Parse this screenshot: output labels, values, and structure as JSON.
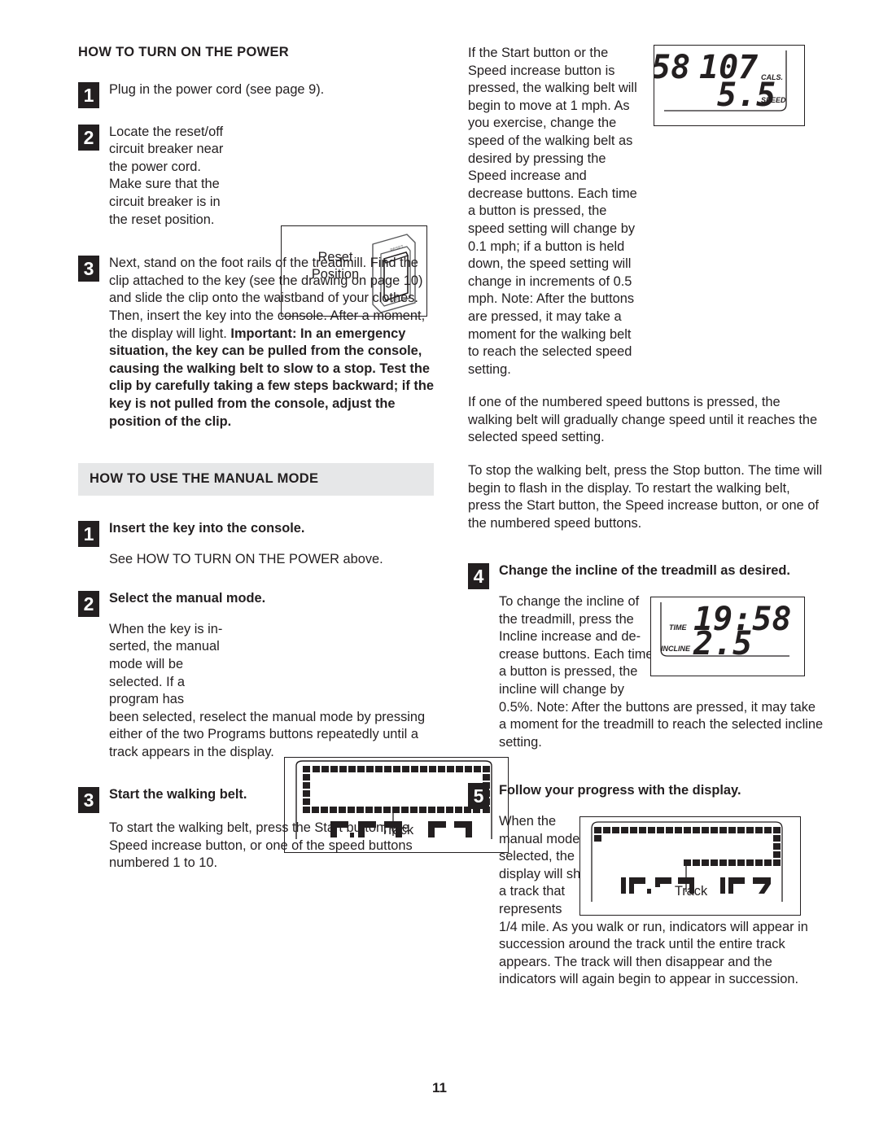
{
  "page": {
    "folio": "11"
  },
  "left_column": {
    "heading_power": "HOW TO TURN ON THE POWER",
    "heading_manual": "HOW TO USE THE MANUAL MODE",
    "steps_power": [
      {
        "num": "1",
        "text": "Plug in the power cord (see page 9)."
      },
      {
        "num": "2",
        "text": "Locate the reset/off circuit breaker near the power cord. Make sure that the circuit breaker is in the reset position."
      },
      {
        "num": "3",
        "text_normal": "Next, stand on the foot rails of the treadmill. Find the clip attached to the key (see the drawing on page 10) and slide the clip onto the waistband of your clothes. Then, insert the key into the console. After a moment, the display will light. ",
        "text_bold": "Important: In an emergency situation, the key can be pulled from the console, causing the walking belt to slow to a stop. Test the clip by carefully taking a few steps backward; if the key is not pulled from the console, adjust the position of the clip."
      }
    ],
    "steps_manual": [
      {
        "num": "1",
        "title": "Insert the key into the console.",
        "body": "See HOW TO TURN ON THE POWER above."
      },
      {
        "num": "2",
        "title": "Select the manual mode.",
        "body_wrap": "When the key is in-serted, the manual mode will be selected. If a program has",
        "body_rest": "been selected, reselect the manual mode by pressing either of the two Programs buttons repeatedly until a track appears in the display."
      },
      {
        "num": "3",
        "title": "Start the walking belt.",
        "body": "To start the walking belt, press the Start button, the Speed increase button, or one of the speed buttons numbered 1 to 10."
      }
    ]
  },
  "right_column": {
    "paragraphs": [
      "If the Start button or the Speed increase button is pressed, the walking belt will begin to move at 1 mph. As you exercise, change the speed of the walking belt as desired by pressing the Speed increase and decrease buttons. Each time a button is pressed, the speed setting will change by 0.1 mph; if a button is held down, the speed setting will change in increments of 0.5 mph. Note: After the buttons are pressed, it may take a moment for the walking belt to reach the selected speed setting.",
      "If one of the numbered speed buttons is pressed, the walking belt will gradually change speed until it reaches the selected speed setting.",
      "To stop the walking belt, press the Stop button. The time will begin to flash in the display. To restart the walking belt, press the Start button, the Speed increase button, or one of the numbered speed buttons."
    ],
    "steps": [
      {
        "num": "4",
        "title": "Change the incline of the treadmill as desired.",
        "body_wrap": "To change the incline of the treadmill, press the Incline increase and de-crease buttons. Each time a button is pressed, the incline will change by",
        "body_rest": "0.5%. Note: After the buttons are pressed, it may take a moment for the treadmill to reach the selected incline setting."
      },
      {
        "num": "5",
        "title": "Follow your progress with the display.",
        "body_wrap": "When the manual mode is selected, the display will show a track that represents",
        "body_rest": "1/4 mile. As you walk or run, indicators will appear in succession around the track until the entire track appears. The track will then disappear and the indicators will again begin to appear in succession."
      }
    ]
  },
  "figures": {
    "breaker": {
      "label_line1": "Reset",
      "label_line2": "Position",
      "switch_top_label": "RESET",
      "switch_bottom_label": "OFF"
    },
    "console_speed": {
      "calories_value": "58",
      "calories_value_2": "107",
      "calories_label": "CALS.",
      "speed_value": "5.5",
      "speed_label": "SPEED"
    },
    "console_incline": {
      "time_label": "TIME",
      "time_value": "19:58",
      "incline_label": "INCLINE",
      "incline_value": "2.5"
    },
    "console_track_full": {
      "callout": "Track"
    },
    "console_track_partial": {
      "callout": "Track"
    }
  },
  "colors": {
    "ink": "#231f20",
    "heading_bar": "#e6e7e8",
    "paper": "#ffffff"
  }
}
